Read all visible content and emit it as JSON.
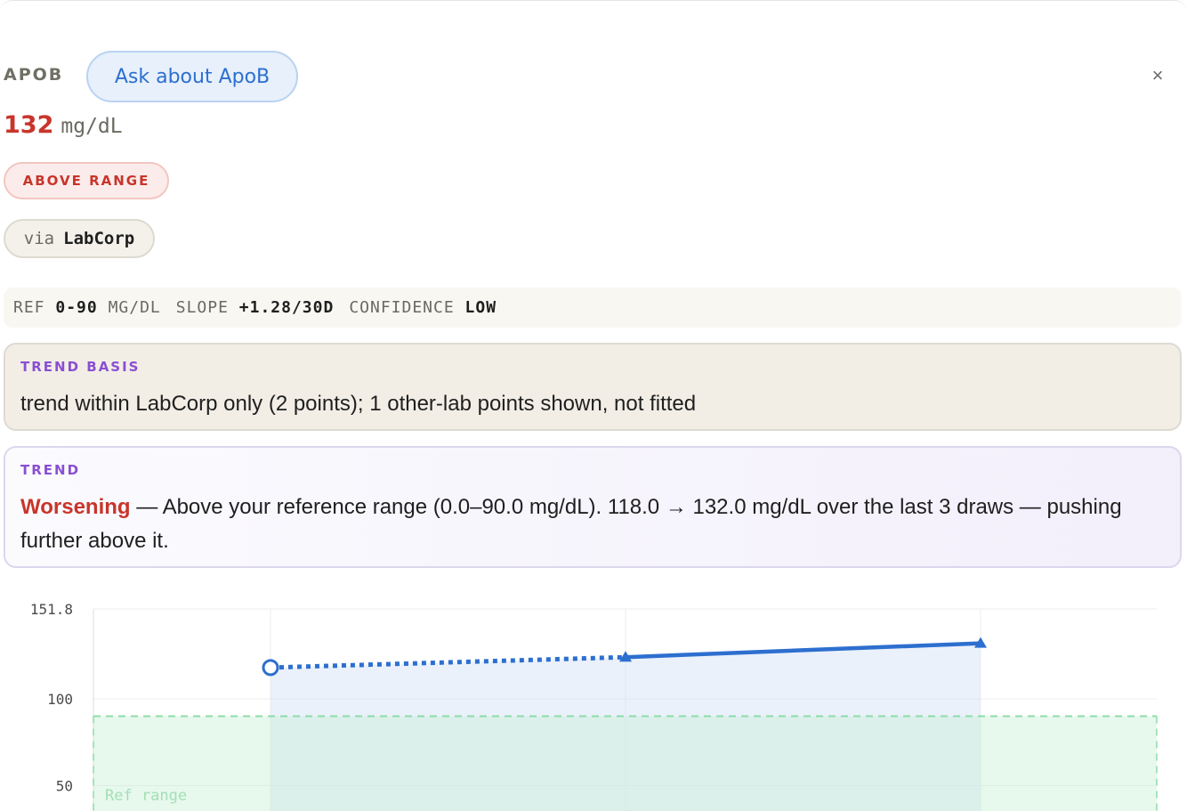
{
  "header": {
    "label": "APOB",
    "ask_button": "Ask about ApoB",
    "close": "×"
  },
  "value": {
    "number": "132",
    "unit": "mg/dL"
  },
  "status_badge": "ABOVE RANGE",
  "source": {
    "prefix": "via",
    "lab": "LabCorp"
  },
  "stats": {
    "ref_key": "REF",
    "ref_value": "0-90",
    "ref_unit": "MG/DL",
    "slope_key": "SLOPE",
    "slope_value": "+1.28/30D",
    "confidence_key": "CONFIDENCE",
    "confidence_value": "LOW"
  },
  "trend_basis": {
    "title": "TREND BASIS",
    "text": "trend within LabCorp only (2 points); 1 other-lab points shown, not fitted"
  },
  "trend": {
    "title": "TREND",
    "status": "Worsening",
    "text_line1": " — Above your reference range (0.0–90.0 mg/dL). 118.0 → 132.0 mg/dL over the last 3 draws — pushing",
    "text_line2": "further above it."
  },
  "colors": {
    "accent_blue": "#2d6fcf",
    "warning_red": "#c8352b",
    "purple_title": "#8a4fd2",
    "ref_range_green": "#e7f8ec"
  },
  "chart_data": {
    "type": "line",
    "y_ticks": [
      "151.8",
      "100",
      "50"
    ],
    "ylim": [
      0,
      151.8
    ],
    "ref_range": [
      0,
      90
    ],
    "ref_label": "Ref range",
    "series": [
      {
        "points": [
          {
            "x": 0,
            "y": 118
          },
          {
            "x": 1,
            "y": 124
          }
        ],
        "style": "dotted",
        "source": "other-lab"
      },
      {
        "points": [
          {
            "x": 1,
            "y": 124
          },
          {
            "x": 2,
            "y": 132
          }
        ],
        "style": "solid",
        "source": "LabCorp"
      }
    ],
    "grid": true
  }
}
